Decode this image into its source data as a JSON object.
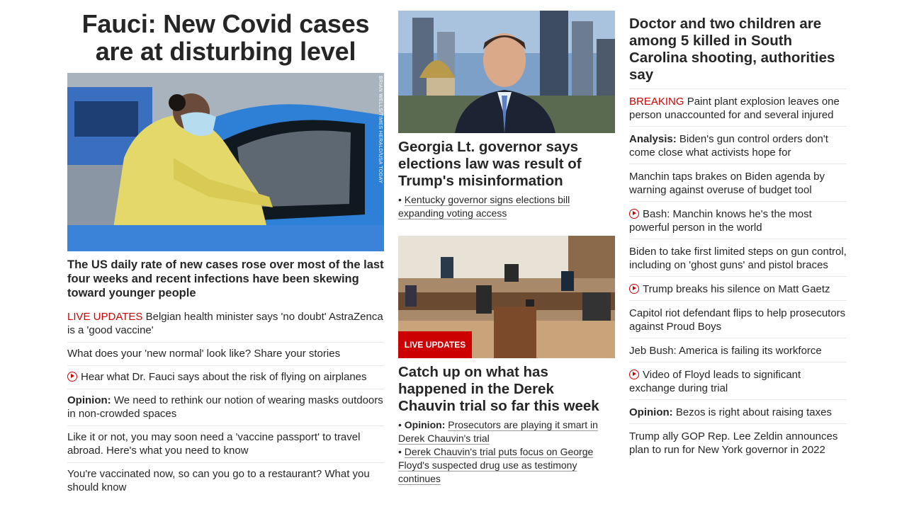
{
  "col1": {
    "headline": "Fauci: New Covid cases are at disturbing level",
    "photo_credit": "BRIAN WELLS/TIMES HERALD/USA TODAY",
    "subhead": "The US daily rate of new cases rose over most of the last four weeks and recent infections have been skewing toward younger people",
    "items": [
      {
        "tag": "LIVE UPDATES",
        "text": "Belgian health minister says 'no doubt' AstraZenca is a 'good vaccine'"
      },
      {
        "text": "What does your 'new normal' look like? Share your stories"
      },
      {
        "text": "Hear what Dr. Fauci says about the risk of flying on airplanes"
      },
      {
        "prefix": "Opinion:",
        "text": "We need to rethink our notion of wearing masks outdoors in non-crowded spaces"
      },
      {
        "text": "Like it or not, you may soon need a 'vaccine passport' to travel abroad. Here's what you need to know"
      },
      {
        "text": "You're vaccinated now, so can you go to a restaurant? What you should know"
      }
    ]
  },
  "col2": {
    "story1": {
      "headline": "Georgia Lt. governor says elections law was result of Trump's misinformation",
      "bullets": [
        "Kentucky governor signs elections bill expanding voting access"
      ]
    },
    "story2": {
      "badge": "LIVE UPDATES",
      "headline": "Catch up on what has happened in the Derek Chauvin trial so far this week",
      "bullet1_prefix": "Opinion:",
      "bullet1_text": "Prosecutors are playing it smart in Derek Chauvin's trial",
      "bullet2_text": "Derek Chauvin's trial puts focus on George Floyd's suspected drug use as testimony continues"
    }
  },
  "col3": {
    "headline": "Doctor and two children are among 5 killed in South Carolina shooting, authorities say",
    "items": [
      {
        "tag": "BREAKING",
        "text": "Paint plant explosion leaves one person unaccounted for and several injured"
      },
      {
        "prefix": "Analysis:",
        "text": "Biden's gun control orders don't come close what activists hope for"
      },
      {
        "text": "Manchin taps brakes on Biden agenda by warning against overuse of budget tool"
      },
      {
        "text": "Bash: Manchin knows he's the most powerful person in the world"
      },
      {
        "text": "Biden to take first limited steps on gun control, including on 'ghost guns' and pistol braces"
      },
      {
        "text": "Trump breaks his silence on Matt Gaetz"
      },
      {
        "text": "Capitol riot defendant flips to help prosecutors against Proud Boys"
      },
      {
        "text": "Jeb Bush: America is failing its workforce"
      },
      {
        "text": "Video of Floyd leads to significant exchange during trial"
      },
      {
        "prefix": "Opinion:",
        "text": "Bezos is right about raising taxes"
      },
      {
        "text": "Trump ally GOP Rep. Lee Zeldin announces plan to run for New York governor in 2022"
      }
    ]
  },
  "colors": {
    "breaking_red": "#cc0000",
    "text": "#262626",
    "divider": "#e6e6e6"
  }
}
